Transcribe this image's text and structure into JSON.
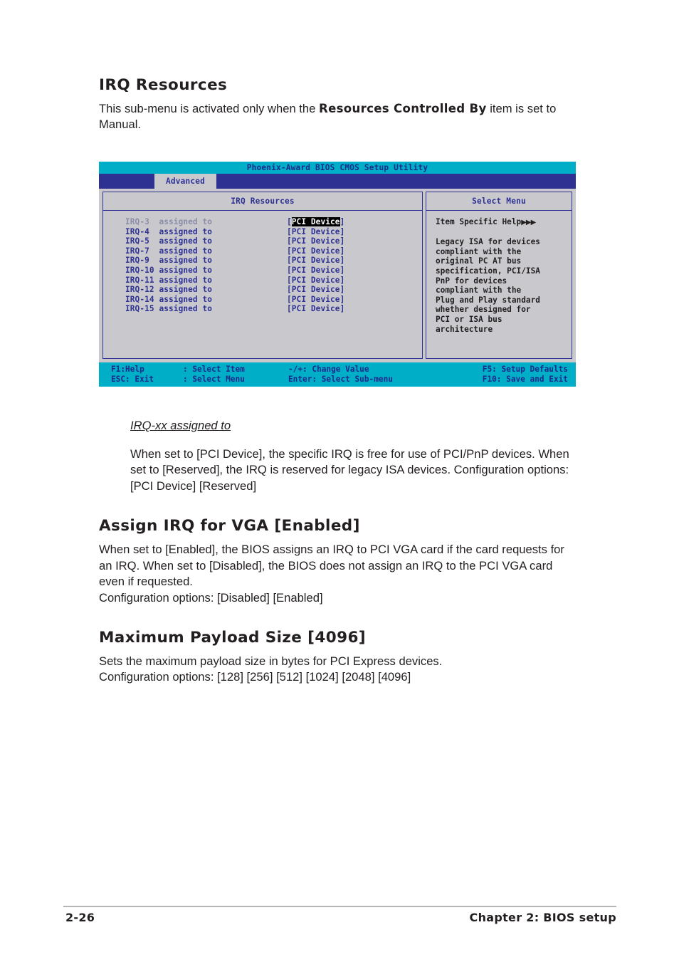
{
  "sections": {
    "irq_resources": {
      "title": "IRQ Resources",
      "intro_before": "This sub-menu is activated only when the ",
      "intro_strong": "Resources Controlled By",
      "intro_after": " item is set to Manual."
    },
    "irq_xx": {
      "sub_head": "IRQ-xx assigned to",
      "body": "When set to [PCI Device], the specific IRQ is free for use of PCI/PnP devices. When set to [Reserved], the IRQ is reserved for legacy ISA devices. Configuration options: [PCI Device] [Reserved]"
    },
    "assign_irq_vga": {
      "title": "Assign IRQ for VGA [Enabled]",
      "body_line1": "When set to [Enabled], the BIOS assigns an IRQ to PCI VGA card if the card requests for an IRQ. When set to [Disabled], the BIOS does not assign an IRQ to the PCI VGA card even if requested.",
      "body_line2": "Configuration options: [Disabled] [Enabled]"
    },
    "max_payload": {
      "title": "Maximum Payload Size [4096]",
      "body_line1": "Sets the maximum payload size in bytes for PCI Express devices.",
      "body_line2": "Configuration options: [128] [256] [512] [1024] [2048] [4096]"
    }
  },
  "bios": {
    "title": "Phoenix-Award BIOS CMOS Setup Utility",
    "active_tab": "Advanced",
    "left_panel_title": "IRQ Resources",
    "right_panel_title": "Select Menu",
    "help_title": "Item Specific Help",
    "help_arrows": "▶▶▶",
    "help_lines": [
      "Legacy ISA for devices",
      "compliant with the",
      "original PC AT bus",
      "specification, PCI/ISA",
      "PnP for devices",
      "compliant with the",
      "Plug and Play standard",
      "whether designed for",
      "PCI or ISA bus",
      "architecture"
    ],
    "irq_rows": [
      {
        "label": "IRQ-3  assigned to",
        "value": "PCI Device",
        "selected": true
      },
      {
        "label": "IRQ-4  assigned to",
        "value": "PCI Device",
        "selected": false
      },
      {
        "label": "IRQ-5  assigned to",
        "value": "PCI Device",
        "selected": false
      },
      {
        "label": "IRQ-7  assigned to",
        "value": "PCI Device",
        "selected": false
      },
      {
        "label": "IRQ-9  assigned to",
        "value": "PCI Device",
        "selected": false
      },
      {
        "label": "IRQ-10 assigned to",
        "value": "PCI Device",
        "selected": false
      },
      {
        "label": "IRQ-11 assigned to",
        "value": "PCI Device",
        "selected": false
      },
      {
        "label": "IRQ-12 assigned to",
        "value": "PCI Device",
        "selected": false
      },
      {
        "label": "IRQ-14 assigned to",
        "value": "PCI Device",
        "selected": false
      },
      {
        "label": "IRQ-15 assigned to",
        "value": "PCI Device",
        "selected": false
      }
    ],
    "footer": {
      "row1": [
        "F1:Help",
        ": Select Item",
        "-/+: Change Value",
        "F5: Setup Defaults"
      ],
      "row2": [
        "ESC: Exit",
        ": Select Menu",
        "Enter: Select Sub-menu",
        "F10: Save and Exit"
      ]
    },
    "colors": {
      "title_bar": "#00AEC7",
      "menu_bar": "#2E3192",
      "panel_bg": "#C9C9CD",
      "accent_text": "#2E3192"
    }
  },
  "page_footer": {
    "page_number": "2-26",
    "chapter": "Chapter 2: BIOS setup"
  }
}
